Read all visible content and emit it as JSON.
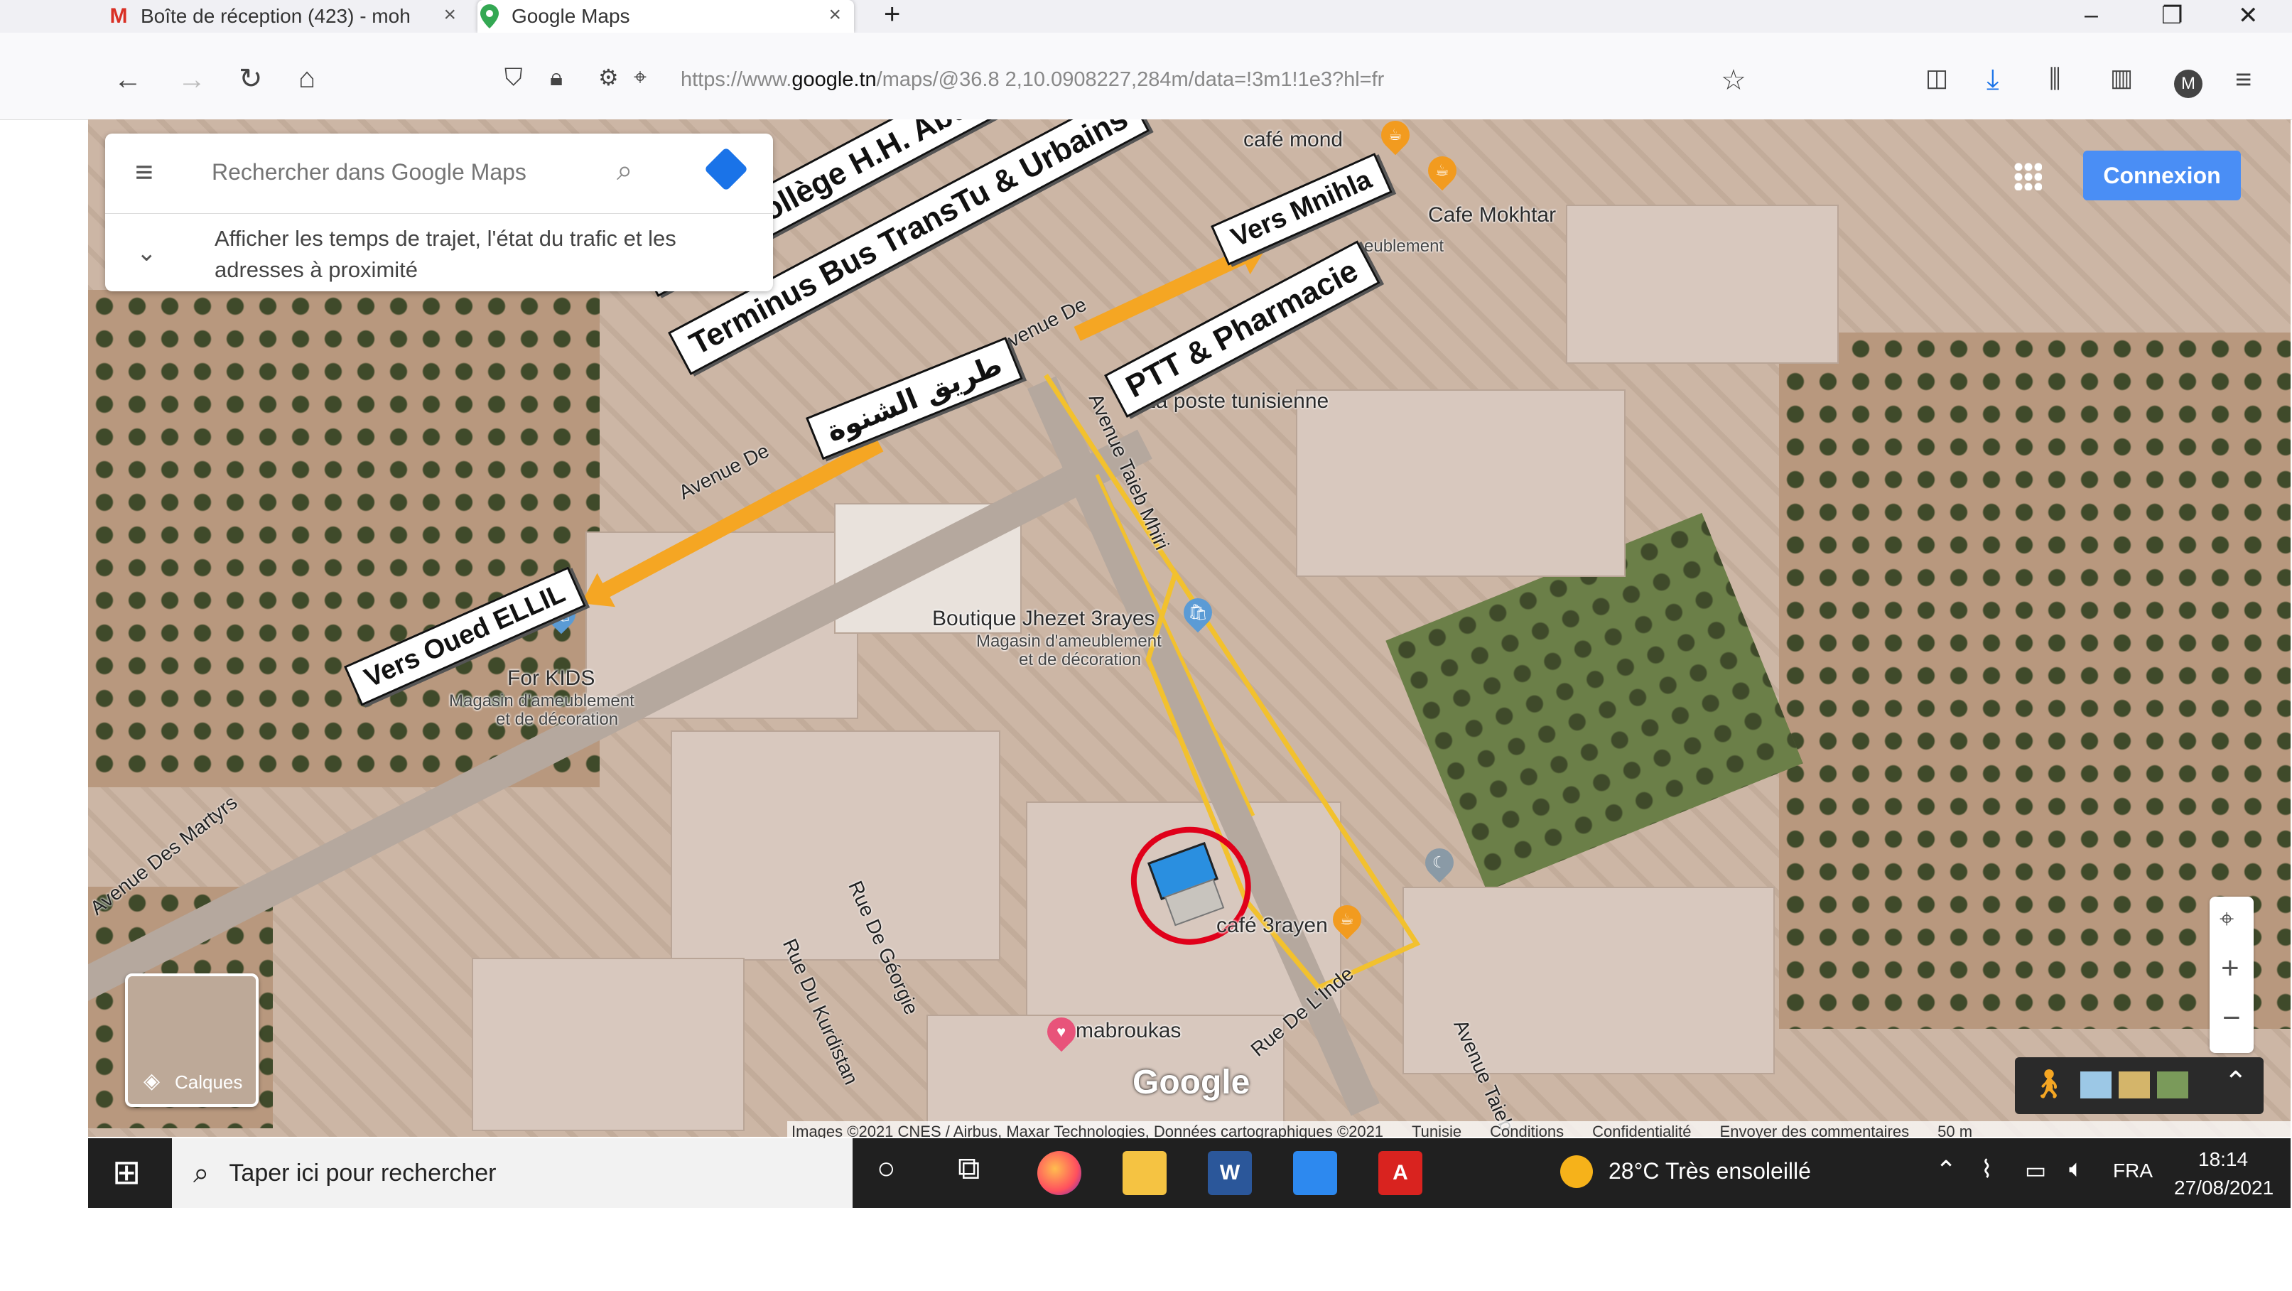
{
  "tabs": [
    {
      "label": "Boîte de réception (423) - moh",
      "icon": "gmail-icon",
      "icon_text": "M"
    },
    {
      "label": "Google Maps",
      "icon": "maps-pin-icon"
    }
  ],
  "url": {
    "prefix": "https://www.",
    "host": "google.tn",
    "path": "/maps/@36.8  2,10.0908227,284m/data=!3m1!1e3?hl=fr"
  },
  "search": {
    "placeholder": "Rechercher dans Google Maps",
    "hint": "Afficher les temps de trajet, l'état du trafic et les adresses à proximité"
  },
  "connexion_label": "Connexion",
  "layers_label": "Calques",
  "google_logo": "Google",
  "map_labels": {
    "cafe_mondial": "café mond",
    "cafe_mokhtar": "Cafe Mokhtar",
    "ameublement": "eublement",
    "poste": "La poste tunisienne",
    "boutique": "Boutique Jhezet 3rayes",
    "boutique_sub1": "Magasin d'ameublement",
    "boutique_sub2": "et de décoration",
    "forkids": "For KIDS",
    "forkids_sub1": "Magasin d'ameublement",
    "forkids_sub2": "et de décoration",
    "cafe_3rayen": "café 3rayen",
    "mabroukas": "mabroukas"
  },
  "streets": {
    "avenue_martyrs": "Avenue Des Martyrs",
    "avenue_martyrs_top": "venue De",
    "avenue_de": "Avenue De",
    "avenue_taieb": "Avenue Taieb Mhiri",
    "rue_georgie": "Rue De Géorgie",
    "rue_kurdistan": "Rue Du Kurdistan",
    "rue_linde": "Rue De L'Inde",
    "avenue_taieb_bottom": "Avenue Taieb"
  },
  "annotations": {
    "lycee": "Lycée  Collège H.H. Abdelwaheb",
    "terminus": "Terminus Bus TransTu & Urbains",
    "vers_mnihla": "Vers Mnihla",
    "ptt": "PTT & Pharmacie",
    "tariq": "طريق الشنوة",
    "vers_oued": "Vers Oued ELLIL"
  },
  "attribution": [
    "Images ©2021 CNES / Airbus, Maxar Technologies, Données cartographiques ©2021",
    "Tunisie",
    "Conditions",
    "Confidentialité",
    "Envoyer des commentaires",
    "50 m"
  ],
  "taskbar": {
    "search_placeholder": "Taper ici pour rechercher",
    "weather": "28°C  Très ensoleillé",
    "lang": "FRA",
    "time": "18:14",
    "date": "27/08/2021"
  },
  "colors": {
    "accent": "#4a8ef5",
    "arrow": "#f5a623",
    "route": "#f2c12e",
    "circle": "#e0001a"
  }
}
